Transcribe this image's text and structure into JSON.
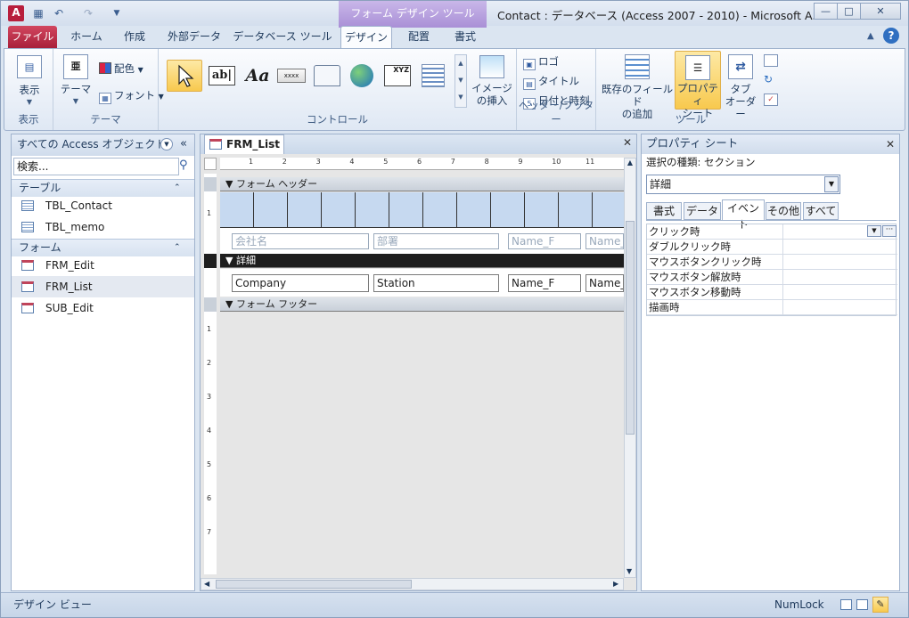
{
  "titlebar": {
    "title": "Contact : データベース (Access 2007 - 2010) - Microsoft A...",
    "context_tab": "フォーム デザイン ツール",
    "app_icon": "A"
  },
  "tabs": [
    "ファイル",
    "ホーム",
    "作成",
    "外部データ",
    "データベース ツール",
    "デザイン",
    "配置",
    "書式"
  ],
  "ribbon": {
    "groups": {
      "view": {
        "label": "表示",
        "button": "表示"
      },
      "theme": {
        "label": "テーマ",
        "theme_button": "テーマ",
        "color": "配色",
        "font": "フォント"
      },
      "controls": {
        "label": "コントロール",
        "label_text": "Aa",
        "button_text": "xxxx",
        "image": "イメージ\nの挿入"
      },
      "header_footer": {
        "label": "ヘッダー/フッター",
        "logo": "ロゴ",
        "title": "タイトル",
        "datetime": "日付と時刻"
      },
      "tools": {
        "label": "ツール",
        "add_fields": "既存のフィールド\nの追加",
        "property_sheet": "プロパティ\nシート",
        "tab_order": "タブ\nオーダー"
      }
    }
  },
  "nav": {
    "header": "すべての Access オブジェクト",
    "search_placeholder": "検索...",
    "groups": [
      {
        "label": "テーブル",
        "items": [
          "TBL_Contact",
          "TBL_memo"
        ]
      },
      {
        "label": "フォーム",
        "items": [
          "FRM_Edit",
          "FRM_List",
          "SUB_Edit"
        ]
      }
    ],
    "selected": "FRM_List"
  },
  "document": {
    "tab": "FRM_List",
    "sections": {
      "header": "フォーム ヘッダー",
      "detail": "詳細",
      "footer": "フォーム フッター"
    },
    "header_labels": [
      "会社名",
      "部署",
      "Name_F",
      "Name_"
    ],
    "detail_fields": [
      "Company",
      "Station",
      "Name_F",
      "Name_"
    ],
    "ruler_marks": [
      "1",
      "2",
      "3",
      "4",
      "5",
      "6",
      "7",
      "8",
      "9",
      "10",
      "11"
    ],
    "vruler_marks": [
      "1",
      "1",
      "2",
      "3",
      "4",
      "5",
      "6",
      "7"
    ]
  },
  "property_sheet": {
    "title": "プロパティ シート",
    "selection_label": "選択の種類: セクション",
    "selected": "詳細",
    "tabs": [
      "書式",
      "データ",
      "イベント",
      "その他",
      "すべて"
    ],
    "active_tab": "イベント",
    "rows": [
      "クリック時",
      "ダブルクリック時",
      "マウスボタンクリック時",
      "マウスボタン解放時",
      "マウスボタン移動時",
      "描画時"
    ]
  },
  "status": {
    "left": "デザイン ビュー",
    "numlock": "NumLock"
  }
}
